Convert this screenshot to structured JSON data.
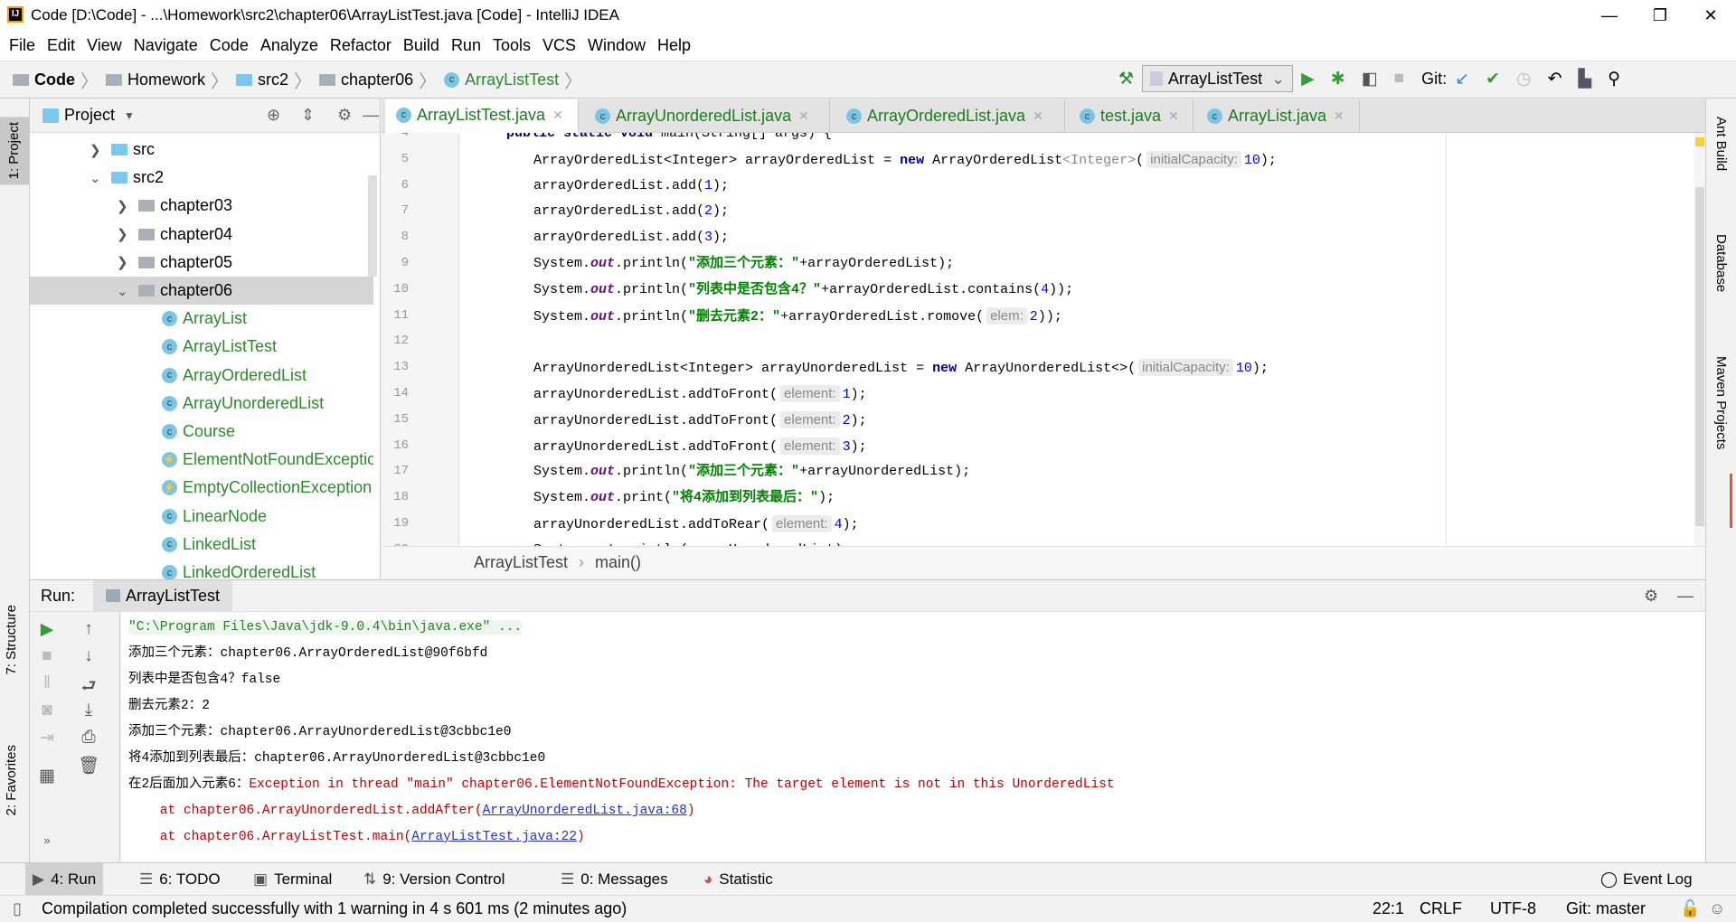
{
  "window": {
    "title": "Code [D:\\Code] - ...\\Homework\\src2\\chapter06\\ArrayListTest.java [Code] - IntelliJ IDEA",
    "app_icon": "IJ"
  },
  "menu": [
    "File",
    "Edit",
    "View",
    "Navigate",
    "Code",
    "Analyze",
    "Refactor",
    "Build",
    "Run",
    "Tools",
    "VCS",
    "Window",
    "Help"
  ],
  "breadcrumb": [
    "Code",
    "Homework",
    "src2",
    "chapter06",
    "ArrayListTest"
  ],
  "toolbar": {
    "run_config": "ArrayListTest",
    "git_label": "Git:"
  },
  "left_strip": {
    "project": "1: Project",
    "structure": "7: Structure",
    "favorites": "2: Favorites"
  },
  "right_strip": {
    "ant": "Ant Build",
    "database": "Database",
    "maven": "Maven Projects"
  },
  "project": {
    "title": "Project",
    "tree": [
      {
        "label": "src",
        "kind": "folder-blue",
        "depth": 0,
        "chevron": "›"
      },
      {
        "label": "src2",
        "kind": "folder-blue",
        "depth": 0,
        "chevron": "⌄"
      },
      {
        "label": "chapter03",
        "kind": "package",
        "depth": 1,
        "chevron": "›"
      },
      {
        "label": "chapter04",
        "kind": "package",
        "depth": 1,
        "chevron": "›"
      },
      {
        "label": "chapter05",
        "kind": "package",
        "depth": 1,
        "chevron": "›"
      },
      {
        "label": "chapter06",
        "kind": "package",
        "depth": 1,
        "chevron": "⌄",
        "selected": true
      },
      {
        "label": "ArrayList",
        "kind": "class",
        "depth": 2
      },
      {
        "label": "ArrayListTest",
        "kind": "class-runnable",
        "depth": 2
      },
      {
        "label": "ArrayOrderedList",
        "kind": "class",
        "depth": 2
      },
      {
        "label": "ArrayUnorderedList",
        "kind": "class",
        "depth": 2
      },
      {
        "label": "Course",
        "kind": "class",
        "depth": 2
      },
      {
        "label": "ElementNotFoundException",
        "kind": "exception",
        "depth": 2
      },
      {
        "label": "EmptyCollectionException",
        "kind": "exception",
        "depth": 2
      },
      {
        "label": "LinearNode",
        "kind": "class",
        "depth": 2
      },
      {
        "label": "LinkedList",
        "kind": "class",
        "depth": 2
      },
      {
        "label": "LinkedOrderedList",
        "kind": "class",
        "depth": 2
      }
    ]
  },
  "tabs": [
    {
      "label": "ArrayListTest.java",
      "active": true
    },
    {
      "label": "ArrayUnorderedList.java"
    },
    {
      "label": "ArrayOrderedList.java"
    },
    {
      "label": "test.java"
    },
    {
      "label": "ArrayList.java"
    }
  ],
  "editor": {
    "lines": [
      {
        "n": "4",
        "indent": "    ",
        "tokens": [
          [
            "kw",
            "public static void "
          ],
          [
            "",
            "main(String[] args) {"
          ]
        ]
      },
      {
        "n": "5",
        "tokens": [
          [
            "",
            "ArrayOrderedList<Integer> arrayOrderedList = "
          ],
          [
            "kw",
            "new "
          ],
          [
            "",
            "ArrayOrderedList"
          ],
          [
            "gen",
            "<Integer>"
          ],
          [
            "",
            "("
          ],
          [
            "hint",
            "initialCapacity:"
          ],
          [
            "num",
            "10"
          ],
          [
            "",
            ");"
          ]
        ]
      },
      {
        "n": "6",
        "tokens": [
          [
            "",
            "arrayOrderedList.add("
          ],
          [
            "num",
            "1"
          ],
          [
            "",
            ");"
          ]
        ]
      },
      {
        "n": "7",
        "tokens": [
          [
            "",
            "arrayOrderedList.add("
          ],
          [
            "num",
            "2"
          ],
          [
            "",
            ");"
          ]
        ]
      },
      {
        "n": "8",
        "tokens": [
          [
            "",
            "arrayOrderedList.add("
          ],
          [
            "num",
            "3"
          ],
          [
            "",
            ");"
          ]
        ]
      },
      {
        "n": "9",
        "tokens": [
          [
            "",
            "System."
          ],
          [
            "fld",
            "out"
          ],
          [
            "",
            ".println("
          ],
          [
            "str",
            "\"添加三个元素：\""
          ],
          [
            "",
            "+arrayOrderedList);"
          ]
        ]
      },
      {
        "n": "10",
        "tokens": [
          [
            "",
            "System."
          ],
          [
            "fld",
            "out"
          ],
          [
            "",
            ".println("
          ],
          [
            "str",
            "\"列表中是否包含4？\""
          ],
          [
            "",
            "+arrayOrderedList.contains("
          ],
          [
            "num",
            "4"
          ],
          [
            "",
            "));"
          ]
        ]
      },
      {
        "n": "11",
        "tokens": [
          [
            "",
            "System."
          ],
          [
            "fld",
            "out"
          ],
          [
            "",
            ".println("
          ],
          [
            "str",
            "\"删去元素2：\""
          ],
          [
            "",
            "+arrayOrderedList.romove("
          ],
          [
            "hint",
            "elem:"
          ],
          [
            "num",
            "2"
          ],
          [
            "",
            "));"
          ]
        ]
      },
      {
        "n": "12",
        "tokens": []
      },
      {
        "n": "13",
        "tokens": [
          [
            "",
            "ArrayUnorderedList<Integer> arrayUnorderedList = "
          ],
          [
            "kw",
            "new "
          ],
          [
            "",
            "ArrayUnorderedList<>("
          ],
          [
            "hint",
            "initialCapacity:"
          ],
          [
            "num",
            "10"
          ],
          [
            "",
            ");"
          ]
        ]
      },
      {
        "n": "14",
        "tokens": [
          [
            "",
            "arrayUnorderedList.addToFront("
          ],
          [
            "hint",
            "element:"
          ],
          [
            "num",
            "1"
          ],
          [
            "",
            ");"
          ]
        ]
      },
      {
        "n": "15",
        "tokens": [
          [
            "",
            "arrayUnorderedList.addToFront("
          ],
          [
            "hint",
            "element:"
          ],
          [
            "num",
            "2"
          ],
          [
            "",
            ");"
          ]
        ]
      },
      {
        "n": "16",
        "tokens": [
          [
            "",
            "arrayUnorderedList.addToFront("
          ],
          [
            "hint",
            "element:"
          ],
          [
            "num",
            "3"
          ],
          [
            "",
            ");"
          ]
        ]
      },
      {
        "n": "17",
        "tokens": [
          [
            "",
            "System."
          ],
          [
            "fld",
            "out"
          ],
          [
            "",
            ".println("
          ],
          [
            "str",
            "\"添加三个元素：\""
          ],
          [
            "",
            "+arrayUnorderedList);"
          ]
        ]
      },
      {
        "n": "18",
        "tokens": [
          [
            "",
            "System."
          ],
          [
            "fld",
            "out"
          ],
          [
            "",
            ".print("
          ],
          [
            "str",
            "\"将4添加到列表最后：\""
          ],
          [
            "",
            ");"
          ]
        ]
      },
      {
        "n": "19",
        "tokens": [
          [
            "",
            "arrayUnorderedList.addToRear("
          ],
          [
            "hint",
            "element:"
          ],
          [
            "num",
            "4"
          ],
          [
            "",
            ");"
          ]
        ]
      },
      {
        "n": "20",
        "tokens": [
          [
            "",
            "System."
          ],
          [
            "fld",
            "out"
          ],
          [
            "",
            ".println(arrayUnorderedList);"
          ]
        ]
      }
    ],
    "breadcrumb": [
      "ArrayListTest",
      "main()"
    ]
  },
  "run": {
    "label": "Run:",
    "tab": "ArrayListTest",
    "console": [
      [
        [
          "cmd",
          "\"C:\\Program Files\\Java\\jdk-9.0.4\\bin\\java.exe\" ..."
        ]
      ],
      [
        [
          "",
          "添加三个元素：chapter06.ArrayOrderedList@90f6bfd"
        ]
      ],
      [
        [
          "",
          "列表中是否包含4？false"
        ]
      ],
      [
        [
          "",
          "删去元素2：2"
        ]
      ],
      [
        [
          "",
          "添加三个元素：chapter06.ArrayUnorderedList@3cbbc1e0"
        ]
      ],
      [
        [
          "",
          "将4添加到列表最后：chapter06.ArrayUnorderedList@3cbbc1e0"
        ]
      ],
      [
        [
          "",
          "在2后面加入元素6："
        ],
        [
          "err",
          "Exception in thread \"main\" chapter06.ElementNotFoundException: The target element is not in this UnorderedList"
        ]
      ],
      [
        [
          "err",
          "    at chapter06.ArrayUnorderedList.addAfter("
        ],
        [
          "lnk",
          "ArrayUnorderedList.java:68"
        ],
        [
          "err",
          ")"
        ]
      ],
      [
        [
          "err",
          "    at chapter06.ArrayListTest.main("
        ],
        [
          "lnk",
          "ArrayListTest.java:22"
        ],
        [
          "err",
          ")"
        ]
      ]
    ]
  },
  "tool_windows": [
    {
      "label": "4: Run",
      "active": true
    },
    {
      "label": "6: TODO"
    },
    {
      "label": "Terminal"
    },
    {
      "label": "9: Version Control"
    },
    {
      "label": "0: Messages"
    },
    {
      "label": "Statistic"
    }
  ],
  "event_log": "Event Log",
  "status": {
    "message": "Compilation completed successfully with 1 warning in 4 s 601 ms (2 minutes ago)",
    "position": "22:1",
    "line_sep": "CRLF",
    "encoding": "UTF-8",
    "git": "Git: master"
  },
  "colors": {
    "keyword": "#000080",
    "string": "#008000",
    "number": "#0000ff",
    "error": "#c00000",
    "run_green": "#3a9a3a",
    "class_icon": "#7ec5e2"
  }
}
